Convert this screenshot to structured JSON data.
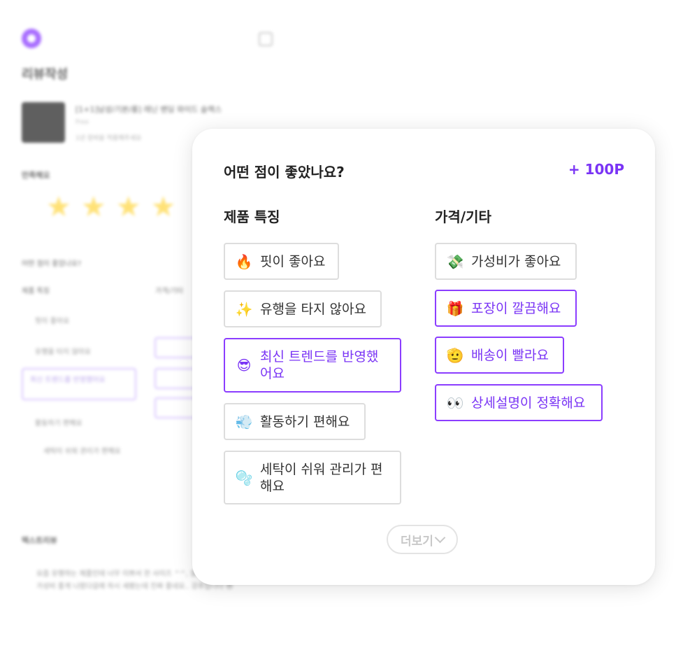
{
  "background": {
    "page_title": "리뷰작성",
    "product_name": "[1+1]남성/기본/롱] 레닌 밴딩 와이드 슬랙스",
    "product_option": "Free",
    "product_note": "1년 장바을 적용해주세요",
    "rating_label": "만족해요",
    "stars": "★★★★",
    "question": "어떤 점이 좋았나요?",
    "col1": "제품 특징",
    "col2": "가격/기타",
    "chips": [
      "핏이 좋아요",
      "유행을 타지 않아요",
      "최신 트렌드를 반영했어요",
      "활동하기 편해요",
      "세탁이 쉬워 관리가 편해요"
    ],
    "text_review_label": "텍스트리뷰",
    "text_review": "요즘 유행하는 제품인데 너무 이쁘서 한 사이즈 ^^, 알려줌에서 이런게 너무 가성비 좋게 나왔다갈래 하시 새봤는데 진짜 좋네요.. 강추입니다 😎"
  },
  "modal": {
    "question": "어떤 점이 좋았나요?",
    "points": "+ 100P",
    "columns": [
      {
        "title": "제품 특징",
        "options": [
          {
            "emoji": "🔥",
            "icon": "fire-icon",
            "label": "핏이 좋아요",
            "selected": false
          },
          {
            "emoji": "✨",
            "icon": "sparkles-icon",
            "label": "유행을 타지 않아요",
            "selected": false
          },
          {
            "emoji": "😎",
            "icon": "sunglasses-face-icon",
            "label": "최신 트렌드를 반영했어요",
            "selected": true
          },
          {
            "emoji": "💨",
            "icon": "dash-icon",
            "label": "활동하기 편해요",
            "selected": false
          },
          {
            "emoji": "🫧",
            "icon": "bubbles-icon",
            "label": "세탁이 쉬워 관리가 편해요",
            "selected": false
          }
        ]
      },
      {
        "title": "가격/기타",
        "options": [
          {
            "emoji": "💸",
            "icon": "money-wings-icon",
            "label": "가성비가 좋아요",
            "selected": false
          },
          {
            "emoji": "🎁",
            "icon": "gift-icon",
            "label": "포장이 깔끔해요",
            "selected": true
          },
          {
            "emoji": "🫡",
            "icon": "saluting-face-icon",
            "label": "배송이 빨라요",
            "selected": true
          },
          {
            "emoji": "👀",
            "icon": "eyes-icon",
            "label": "상세설명이 정확해요",
            "selected": true
          }
        ]
      }
    ],
    "more_label": "더보기"
  }
}
